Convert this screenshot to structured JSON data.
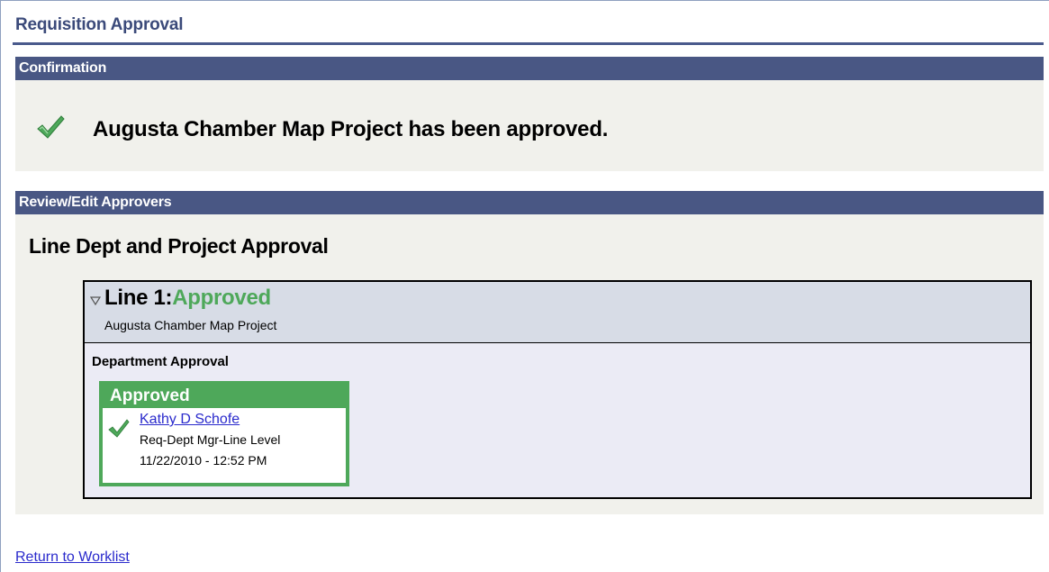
{
  "page": {
    "title": "Requisition Approval"
  },
  "confirmation": {
    "header": "Confirmation",
    "icon": "green-check-icon",
    "message": "Augusta Chamber Map Project has been approved."
  },
  "review": {
    "header": "Review/Edit Approvers",
    "group_title": "Line Dept and Project Approval",
    "line": {
      "expand_icon": "triangle-down-icon",
      "label": "Line 1:",
      "status": "Approved",
      "description": "Augusta Chamber Map Project",
      "stage": "Department Approval",
      "approver": {
        "status": "Approved",
        "icon": "green-check-icon",
        "name": "Kathy D Schofe",
        "role": "Req-Dept Mgr-Line Level",
        "timestamp": "11/22/2010 - 12:52 PM"
      }
    }
  },
  "footer": {
    "return_link": "Return to Worklist"
  },
  "colors": {
    "section_header_bg": "#495784",
    "section_body_bg": "#f1f1ec",
    "approved_green": "#4ea85a",
    "link_blue": "#2a2acc",
    "title_color": "#3b4a7a"
  }
}
